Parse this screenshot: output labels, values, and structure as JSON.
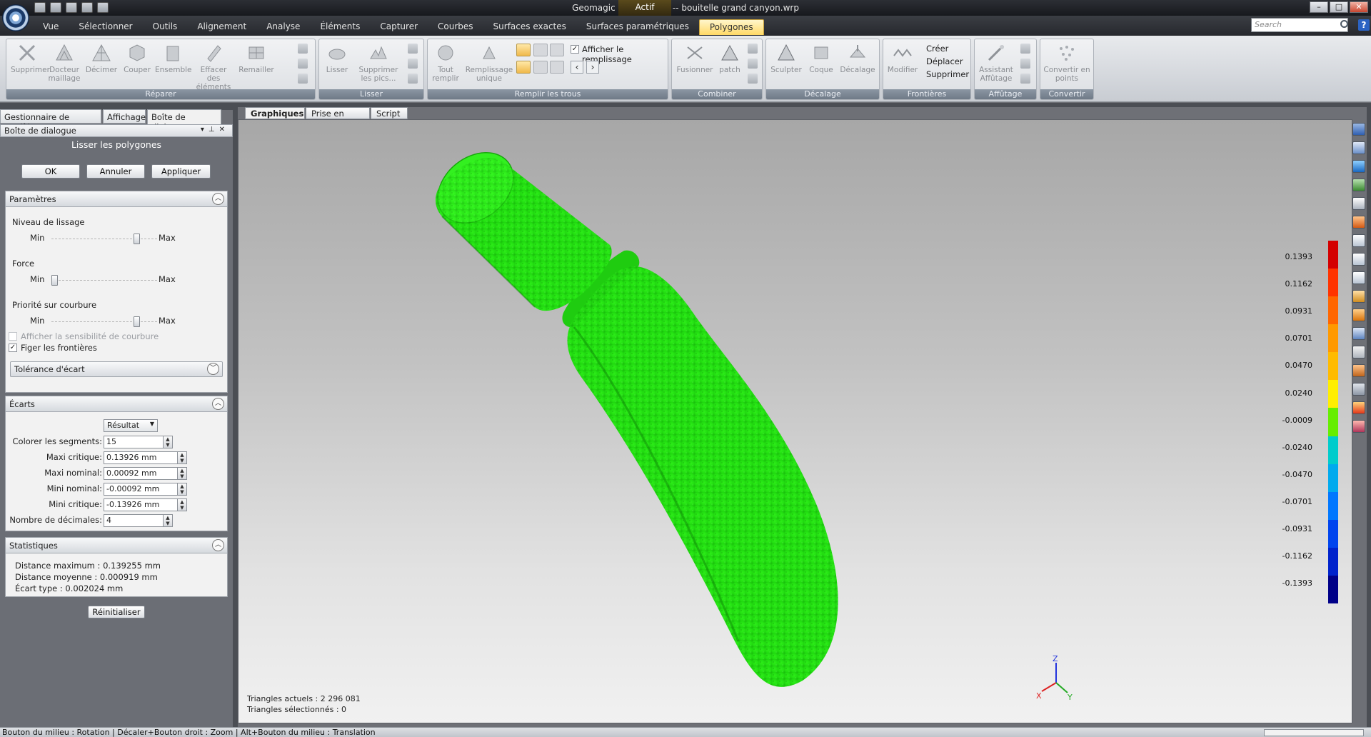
{
  "app": {
    "title": "Geomagic Studio 2012 -- bouitelle grand canyon.wrp",
    "context_tab": "Actif"
  },
  "window_buttons": [
    "–",
    "□",
    "✕"
  ],
  "menu": {
    "tabs": [
      "Vue",
      "Sélectionner",
      "Outils",
      "Alignement",
      "Analyse",
      "Éléments",
      "Capturer",
      "Courbes",
      "Surfaces exactes",
      "Surfaces paramétriques",
      "Polygones"
    ],
    "active": "Polygones",
    "search_placeholder": "Search",
    "help": "?"
  },
  "ribbon": {
    "groups": {
      "reparer": {
        "label": "Réparer",
        "buttons": [
          "Supprimer",
          "Docteur maillage",
          "Décimer",
          "Couper",
          "Ensemble",
          "Effacer des éléments",
          "Remailler"
        ]
      },
      "lisser": {
        "label": "Lisser",
        "buttons": [
          "Lisser",
          "Supprimer les pics..."
        ]
      },
      "remplir": {
        "label": "Remplir les trous",
        "buttons": [
          "Tout remplir",
          "Remplissage unique"
        ],
        "checkbox": "Afficher le remplissage"
      },
      "combiner": {
        "label": "Combiner",
        "buttons": [
          "Fusionner",
          "patch"
        ]
      },
      "decalage": {
        "label": "Décalage",
        "buttons": [
          "Sculpter",
          "Coque",
          "Décalage"
        ]
      },
      "frontieres": {
        "label": "Frontières",
        "buttons": [
          "Modifier"
        ],
        "small": [
          "Créer",
          "Déplacer",
          "Supprimer"
        ]
      },
      "affutage": {
        "label": "Affûtage",
        "buttons": [
          "Assistant Affûtage"
        ]
      },
      "convertir": {
        "label": "Convertir",
        "buttons": [
          "Convertir en points"
        ]
      }
    }
  },
  "left_panel": {
    "tabs": [
      "Gestionnaire de modèles",
      "Affichage",
      "Boîte de dialogue"
    ],
    "active_tab": "Boîte de dialogue",
    "header": "Boîte de dialogue",
    "dialog_title": "Lisser les polygones",
    "buttons": {
      "ok": "OK",
      "cancel": "Annuler",
      "apply": "Appliquer"
    },
    "parametres": {
      "title": "Paramètres",
      "sliders": [
        {
          "label": "Niveau de lissage",
          "min": "Min",
          "max": "Max",
          "value": 0.83
        },
        {
          "label": "Force",
          "min": "Min",
          "max": "Max",
          "value": 0.0
        },
        {
          "label": "Priorité sur courbure",
          "min": "Min",
          "max": "Max",
          "value": 0.83
        }
      ],
      "chk_sensibilite": "Afficher la sensibilité de courbure",
      "chk_figer": "Figer les frontières",
      "tolerance": "Tolérance d'écart"
    },
    "ecarts": {
      "title": "Écarts",
      "mode": "Résultat",
      "rows": [
        {
          "label": "Colorer les segments:",
          "value": "15"
        },
        {
          "label": "Maxi critique:",
          "value": "0.13926 mm"
        },
        {
          "label": "Maxi nominal:",
          "value": "0.00092 mm"
        },
        {
          "label": "Mini nominal:",
          "value": "-0.00092 mm"
        },
        {
          "label": "Mini critique:",
          "value": "-0.13926 mm"
        },
        {
          "label": "Nombre de décimales:",
          "value": "4"
        }
      ]
    },
    "statistiques": {
      "title": "Statistiques",
      "lines": [
        "Distance maximum : 0.139255 mm",
        "Distance moyenne : 0.000919 mm",
        "Écart type : 0.002024 mm"
      ],
      "reset": "Réinitialiser"
    }
  },
  "viewport": {
    "tabs": [
      "Graphiques",
      "Prise en main",
      "Script"
    ],
    "active_tab": "Graphiques",
    "stats": [
      "Triangles actuels : 2 296 081",
      "Triangles sélectionnés : 0"
    ],
    "axis_labels": {
      "z": "Z",
      "x": "X",
      "y": "Y"
    },
    "colorbar_labels": [
      "0.1393",
      "0.1162",
      "0.0931",
      "0.0701",
      "0.0470",
      "0.0240",
      "-0.0009",
      "-0.0240",
      "-0.0470",
      "-0.0701",
      "-0.0931",
      "-0.1162",
      "-0.1393"
    ],
    "colorbar_colors": [
      "#d40000",
      "#ff3300",
      "#ff6600",
      "#ff9900",
      "#ffbb00",
      "#ffee00",
      "#66ee00",
      "#00cccc",
      "#00aaee",
      "#0077ff",
      "#0044ee",
      "#0022cc",
      "#000088"
    ],
    "model_color": "#22dd11"
  },
  "status_bar": "Bouton du milieu : Rotation | Décaler+Bouton droit : Zoom | Alt+Bouton du milieu : Translation"
}
